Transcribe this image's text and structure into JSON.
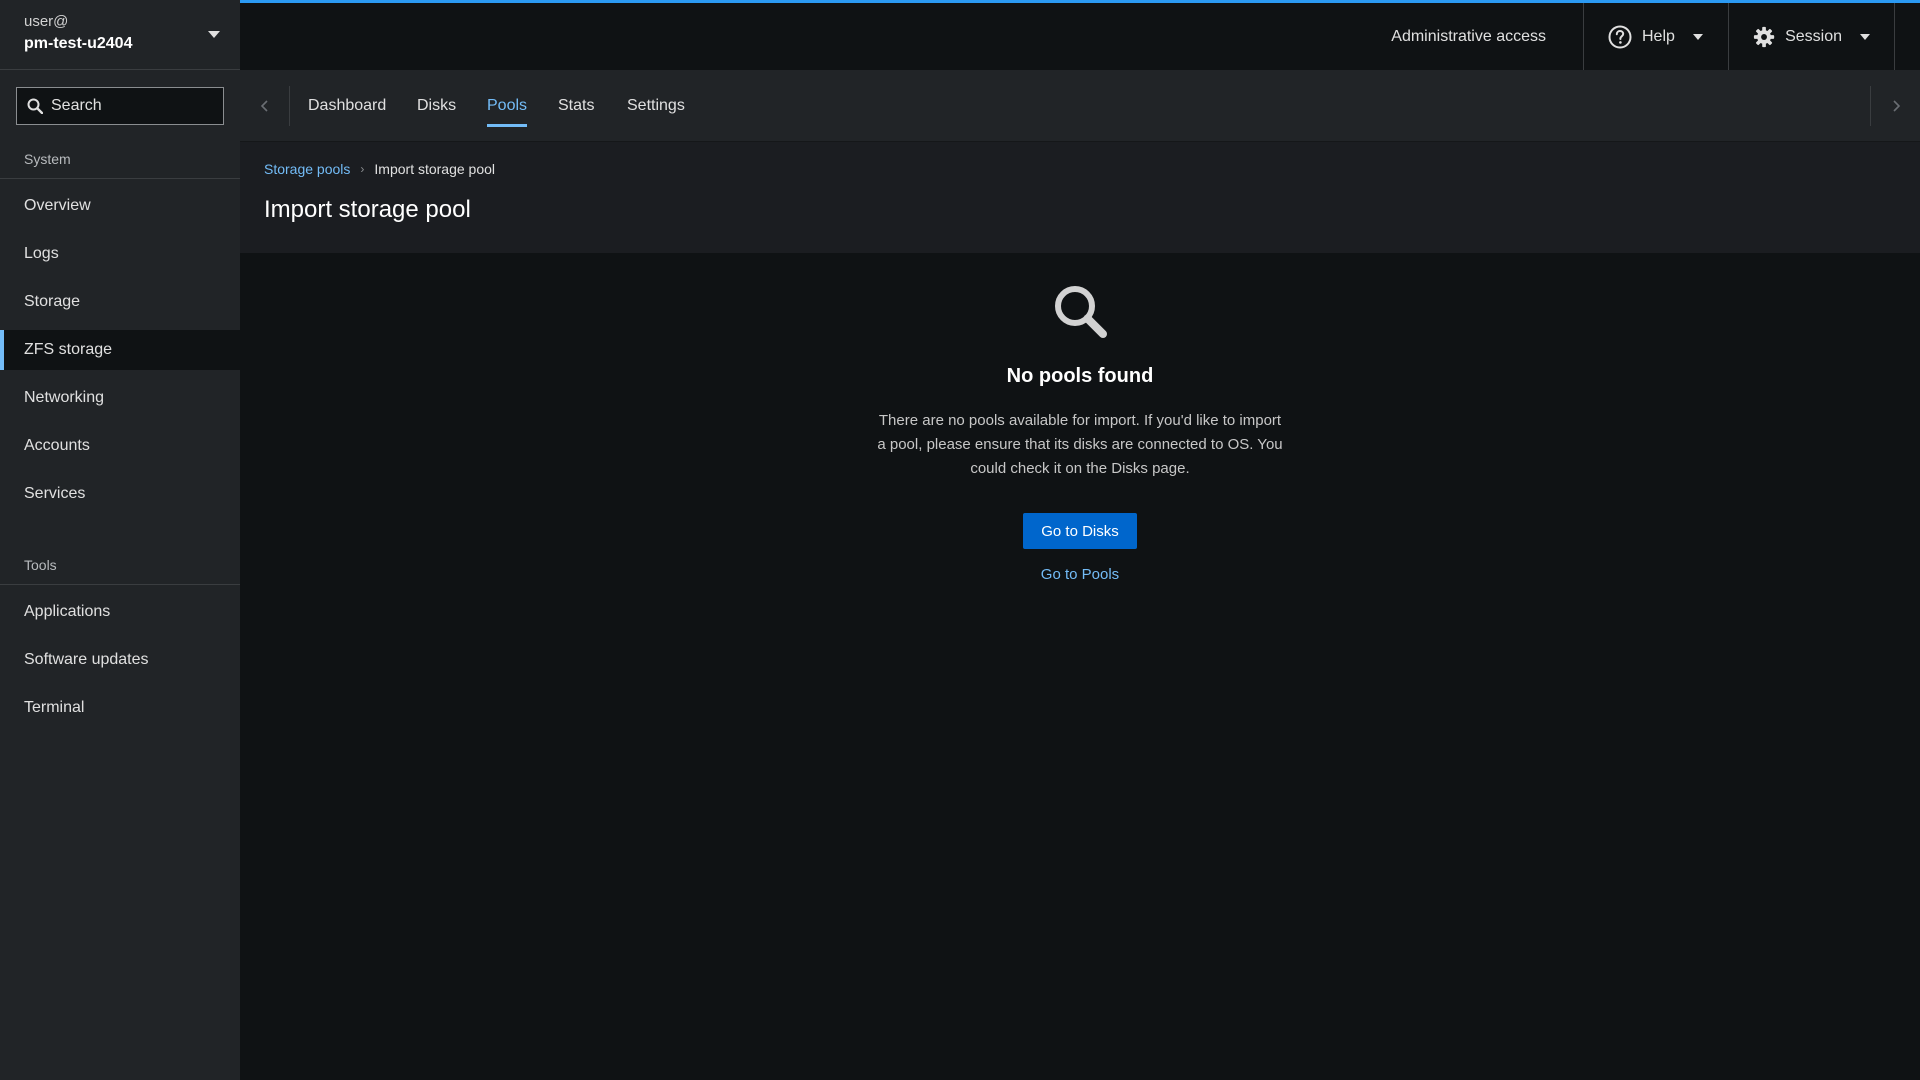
{
  "host": {
    "user": "user@",
    "name": "pm-test-u2404"
  },
  "search": {
    "placeholder": "Search"
  },
  "nav": {
    "sections": [
      {
        "title": "System"
      },
      {
        "title": "Tools"
      }
    ],
    "system_items": [
      {
        "label": "Overview"
      },
      {
        "label": "Logs"
      },
      {
        "label": "Storage"
      },
      {
        "label": "ZFS storage",
        "active": true
      },
      {
        "label": "Networking"
      },
      {
        "label": "Accounts"
      },
      {
        "label": "Services"
      }
    ],
    "tools_items": [
      {
        "label": "Applications"
      },
      {
        "label": "Software updates"
      },
      {
        "label": "Terminal"
      }
    ]
  },
  "masthead": {
    "admin_access": "Administrative access",
    "help": "Help",
    "session": "Session"
  },
  "tabs": [
    {
      "label": "Dashboard"
    },
    {
      "label": "Disks"
    },
    {
      "label": "Pools",
      "active": true
    },
    {
      "label": "Stats"
    },
    {
      "label": "Settings"
    }
  ],
  "breadcrumb": {
    "parent": "Storage pools",
    "current": "Import storage pool"
  },
  "page": {
    "title": "Import storage pool"
  },
  "empty_state": {
    "title": "No pools found",
    "body": "There are no pools available for import. If you'd like to import a pool, please ensure that its disks are connected to OS. You could check it on the Disks page.",
    "primary_action": "Go to Disks",
    "secondary_action": "Go to Pools"
  },
  "colors": {
    "accent": "#73bcf7",
    "primary_button": "#0066cc",
    "masthead_border": "#2b9af3"
  }
}
